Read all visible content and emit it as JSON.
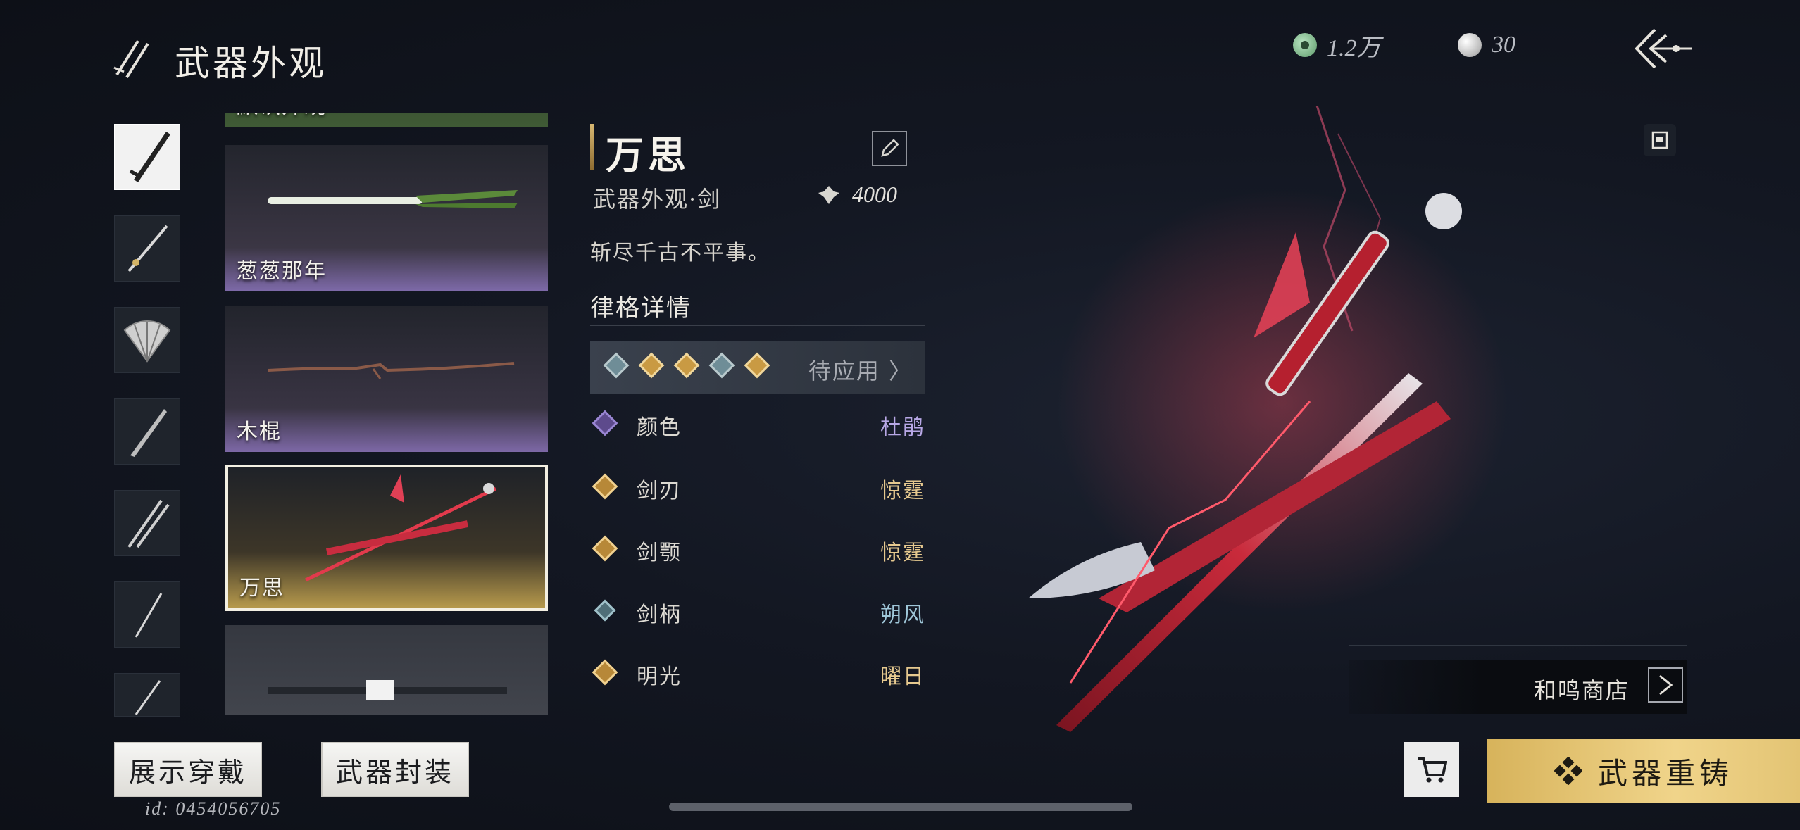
{
  "header": {
    "title": "武器外观",
    "currency_jade": "1.2万",
    "currency_pearl": "30"
  },
  "skins": [
    {
      "name": "默认外观"
    },
    {
      "name": "葱葱那年"
    },
    {
      "name": "木棍"
    },
    {
      "name": "万思"
    }
  ],
  "detail": {
    "weapon_name": "万思",
    "weapon_type": "武器外观·剑",
    "power": "4000",
    "description": "斩尽千古不平事。",
    "section_title": "律格详情",
    "rune_status": "待应用 〉",
    "attributes": [
      {
        "label": "颜色",
        "value": "杜鹃",
        "value_color": "#b8a8e6",
        "icon_color": "#8c6cc8"
      },
      {
        "label": "剑刃",
        "value": "惊霆",
        "value_color": "#e6c98f",
        "icon_color": "#c9a05a"
      },
      {
        "label": "剑颚",
        "value": "惊霆",
        "value_color": "#e6c98f",
        "icon_color": "#c9a05a"
      },
      {
        "label": "剑柄",
        "value": "朔风",
        "value_color": "#9fc7d9",
        "icon_color": "#7aa2b1"
      },
      {
        "label": "明光",
        "value": "曜日",
        "value_color": "#e6c98f",
        "icon_color": "#c9a05a"
      }
    ]
  },
  "shop": {
    "label": "和鸣商店"
  },
  "buttons": {
    "show": "展示穿戴",
    "seal": "武器封装",
    "reforge": "武器重铸"
  },
  "player_id": "id: 0454056705",
  "colors": {
    "accent_gold": "#e3c474",
    "background": "#131722"
  },
  "icons": [
    "twin-swords-icon",
    "jade-coin-icon",
    "pearl-icon",
    "back-arrow-icon",
    "share-icon",
    "edit-pencil-icon",
    "power-emblem-icon",
    "chevron-right-icon",
    "cart-icon",
    "reforge-diamond-icon"
  ]
}
